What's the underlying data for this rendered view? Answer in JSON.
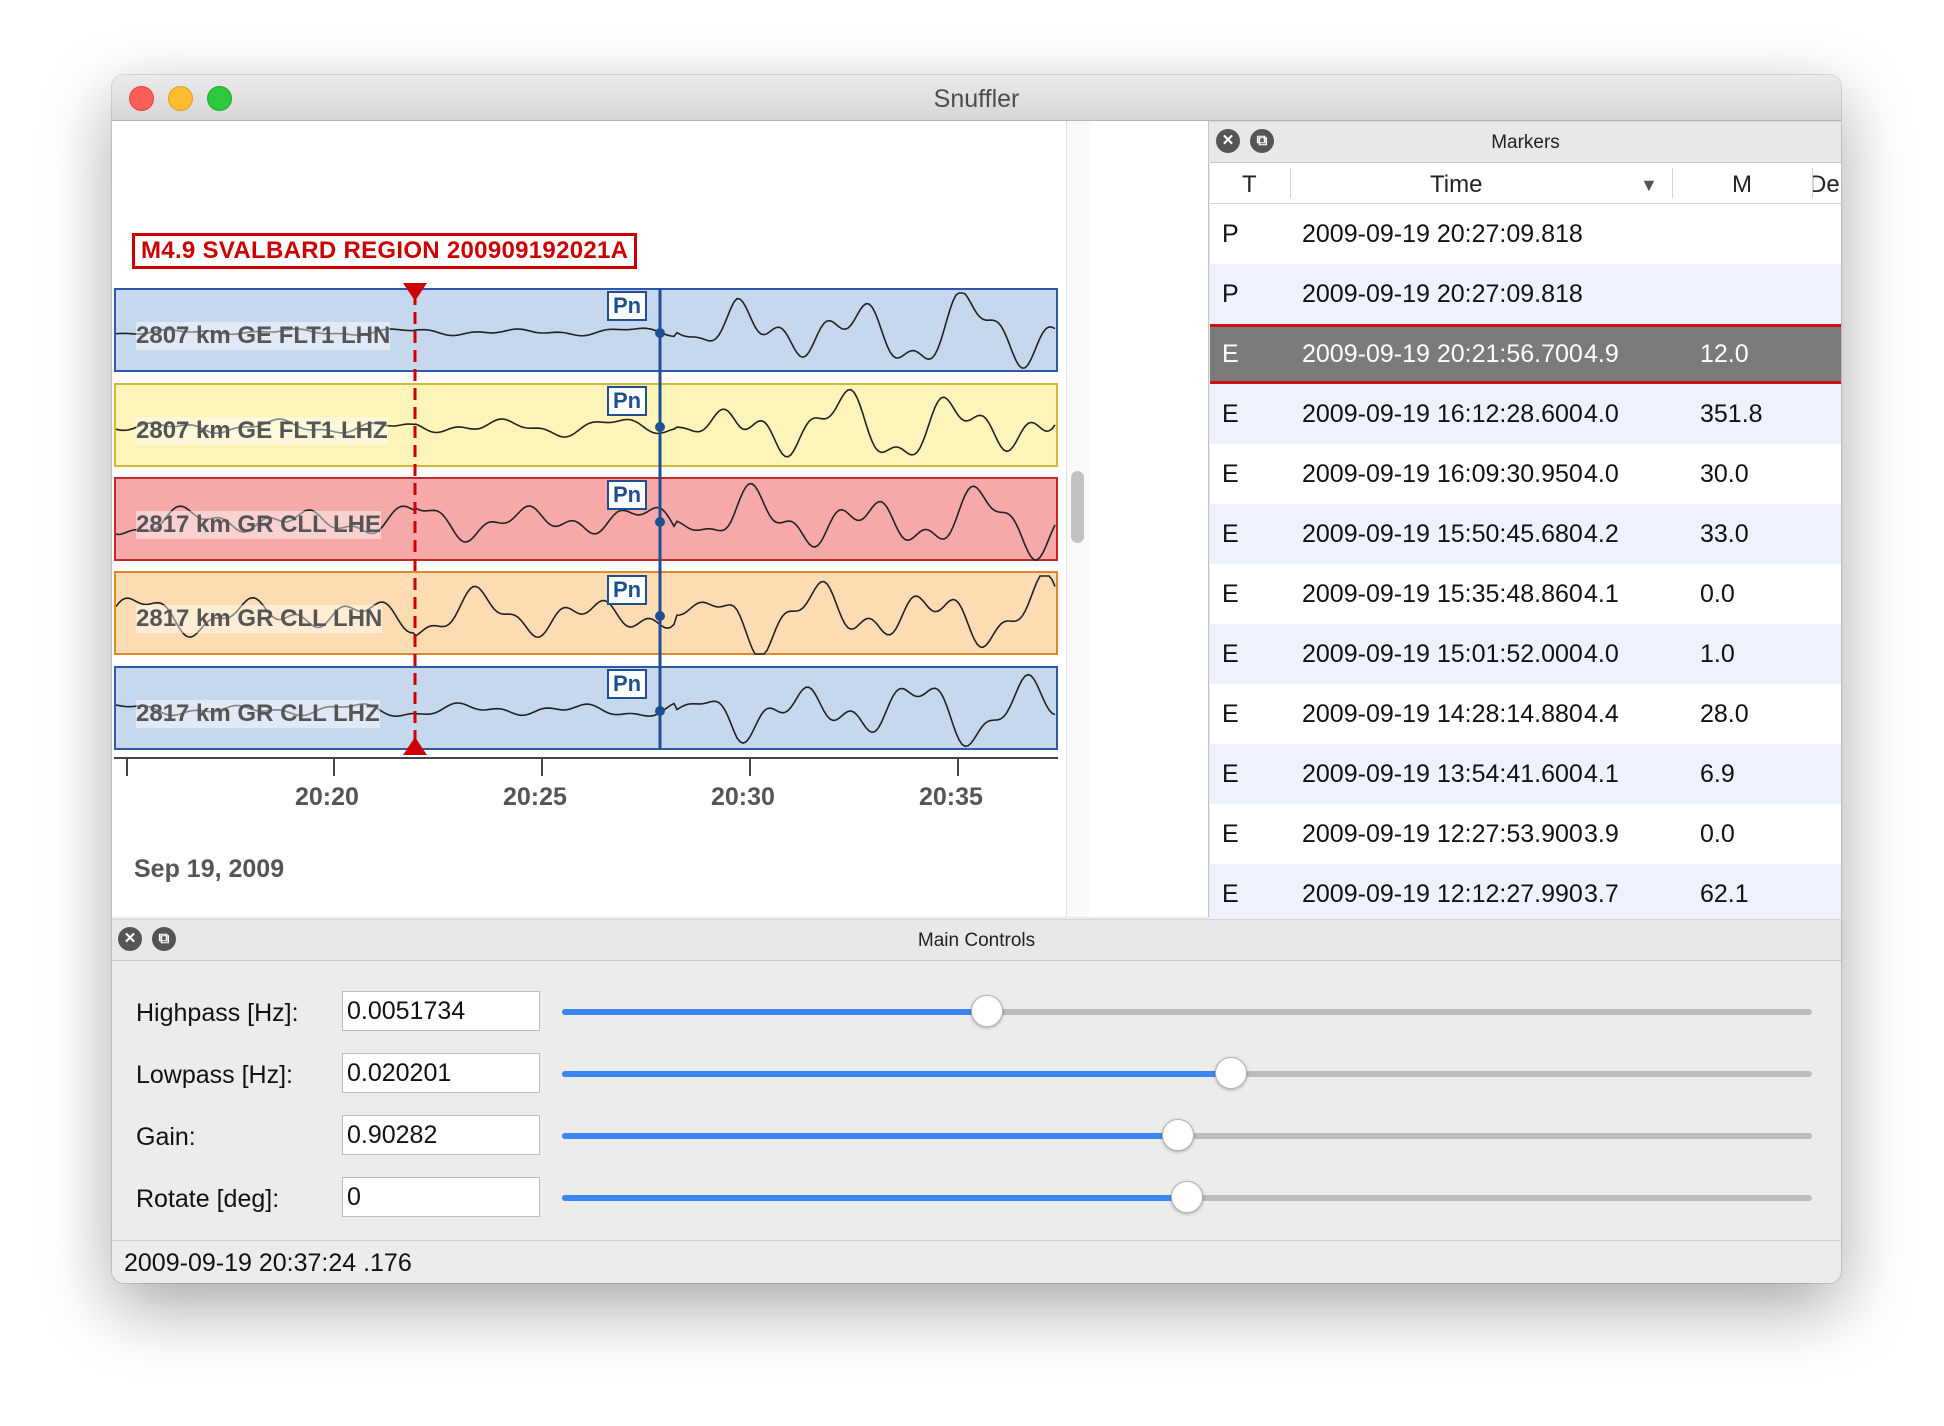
{
  "window": {
    "title": "Snuffler"
  },
  "trace_view": {
    "event_label": "M4.9 SVALBARD REGION 200909192021A",
    "phase_label": "Pn",
    "traces": [
      {
        "label": "2807 km GE FLT1  LHN",
        "bg": "#c6d8ed",
        "border": "#2f58a8"
      },
      {
        "label": "2807 km GE FLT1  LHZ",
        "bg": "#fcf4b8",
        "border": "#d4b73c"
      },
      {
        "label": "2817 km GR CLL  LHE",
        "bg": "#f7a9aa",
        "border": "#c22a2a"
      },
      {
        "label": "2817 km GR CLL  LHN",
        "bg": "#fddcb3",
        "border": "#dd8a2e"
      },
      {
        "label": "2817 km GR CLL  LHZ",
        "bg": "#c6d8ed",
        "border": "#2f58a8"
      }
    ],
    "time_axis": {
      "ticks": [
        "20:20",
        "20:25",
        "20:30",
        "20:35"
      ],
      "date": "Sep 19, 2009"
    },
    "event_marker_color": "#cc0000",
    "phase_marker_color": "#1f4f93"
  },
  "markers": {
    "title": "Markers",
    "columns": [
      "T",
      "Time",
      "M",
      "Depth [km]"
    ],
    "sort_indicator": "▼",
    "rows": [
      {
        "t": "P",
        "time": "2009-09-19 20:27:09.818",
        "m": "",
        "depth": ""
      },
      {
        "t": "P",
        "time": "2009-09-19 20:27:09.818",
        "m": "",
        "depth": ""
      },
      {
        "t": "E",
        "time": "2009-09-19 20:21:56.700",
        "m": "4.9",
        "depth": "12.0"
      },
      {
        "t": "E",
        "time": "2009-09-19 16:12:28.600",
        "m": "4.0",
        "depth": "351.8"
      },
      {
        "t": "E",
        "time": "2009-09-19 16:09:30.950",
        "m": "4.0",
        "depth": "30.0"
      },
      {
        "t": "E",
        "time": "2009-09-19 15:50:45.680",
        "m": "4.2",
        "depth": "33.0"
      },
      {
        "t": "E",
        "time": "2009-09-19 15:35:48.860",
        "m": "4.1",
        "depth": "0.0"
      },
      {
        "t": "E",
        "time": "2009-09-19 15:01:52.000",
        "m": "4.0",
        "depth": "1.0"
      },
      {
        "t": "E",
        "time": "2009-09-19 14:28:14.880",
        "m": "4.4",
        "depth": "28.0"
      },
      {
        "t": "E",
        "time": "2009-09-19 13:54:41.600",
        "m": "4.1",
        "depth": "6.9"
      },
      {
        "t": "E",
        "time": "2009-09-19 12:27:53.900",
        "m": "3.9",
        "depth": "0.0"
      },
      {
        "t": "E",
        "time": "2009-09-19 12:12:27.990",
        "m": "3.7",
        "depth": "62.1"
      }
    ],
    "selected_index": 2
  },
  "controls": {
    "title": "Main Controls",
    "rows": [
      {
        "label": "Highpass [Hz]:",
        "value": "0.0051734",
        "level": 0.34
      },
      {
        "label": "Lowpass [Hz]:",
        "value": "0.020201",
        "level": 0.535
      },
      {
        "label": "Gain:",
        "value": "0.90282",
        "level": 0.493
      },
      {
        "label": "Rotate [deg]:",
        "value": "0",
        "level": 0.5
      }
    ]
  },
  "status": {
    "text": "2009-09-19 20:37:24 .176"
  },
  "colors": {
    "slider_fill": "#3d86f1",
    "selected_row": "#7b7b7b",
    "selection_border": "#cc1111"
  }
}
